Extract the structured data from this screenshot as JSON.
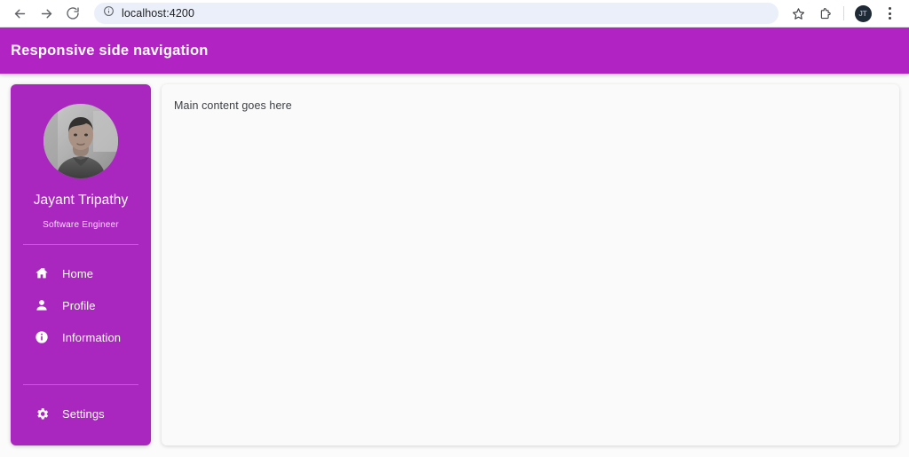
{
  "browser": {
    "back_label": "Back",
    "forward_label": "Forward",
    "reload_label": "Reload",
    "url": "localhost:4200",
    "site_info_icon": "info-circle-icon",
    "bookmark_icon": "star-icon",
    "extensions_icon": "puzzle-piece-icon",
    "profile_initial": "JT",
    "menu_icon": "kebab-menu-icon"
  },
  "header": {
    "title": "Responsive side navigation",
    "background": "#b223c4"
  },
  "sidebar": {
    "background": "#a927be",
    "profile": {
      "avatar_icon": "user-photo-avatar",
      "name": "Jayant Tripathy",
      "role": "Software Engineer"
    },
    "items": [
      {
        "label": "Home",
        "icon": "home-icon"
      },
      {
        "label": "Profile",
        "icon": "person-icon"
      },
      {
        "label": "Information",
        "icon": "info-icon"
      }
    ],
    "bottom_items": [
      {
        "label": "Settings",
        "icon": "gear-icon"
      }
    ]
  },
  "main": {
    "text": "Main content goes here"
  }
}
